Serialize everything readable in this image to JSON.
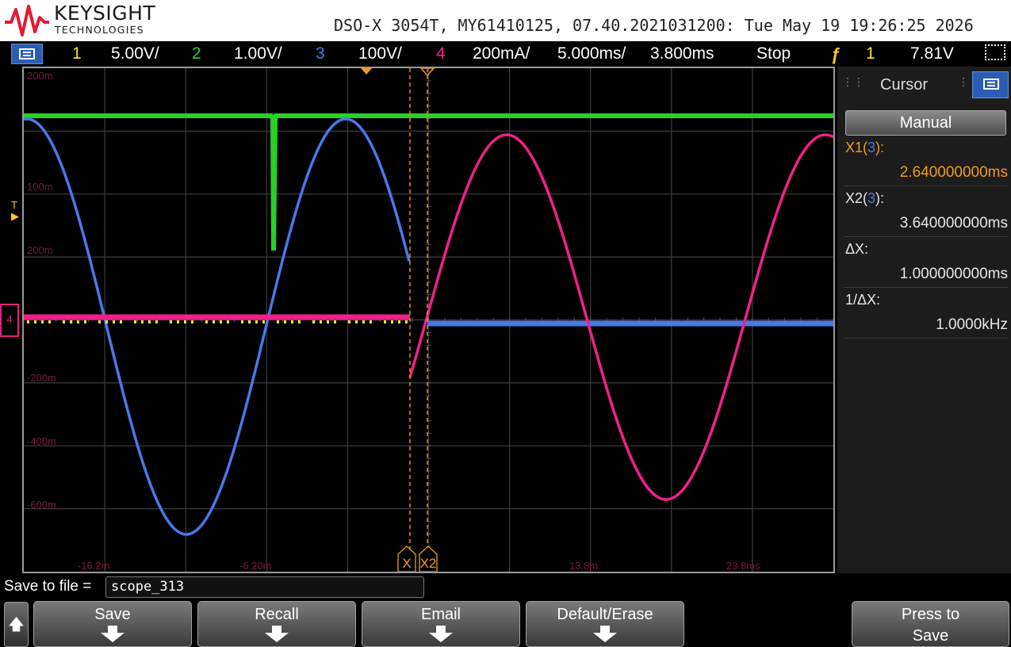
{
  "brand": {
    "name": "KEYSIGHT",
    "subtitle": "TECHNOLOGIES",
    "logo_color": "#e41a32"
  },
  "instrument_info": "DSO-X 3054T, MY61410125, 07.40.2021031200: Tue May 19 19:26:25 2026",
  "statusbar": {
    "menu_icon": "menu-icon",
    "channels": [
      {
        "num": "1",
        "scale": "5.00V/",
        "color": "#f8e030"
      },
      {
        "num": "2",
        "scale": "1.00V/",
        "color": "#28d028"
      },
      {
        "num": "3",
        "scale": "100V/",
        "color": "#4a78e8"
      },
      {
        "num": "4",
        "scale": "200mA/",
        "color": "#f0208a"
      }
    ],
    "timebase": "5.000ms/",
    "delay": "3.800ms",
    "run_state": "Stop",
    "trigger_icon": "trigger-edge-icon",
    "trigger_source": "1",
    "trigger_level": "7.81V",
    "acquire_icon": "acquire-icon"
  },
  "graticule": {
    "y_labels": [
      "200m",
      "100m",
      "200m",
      "-200m",
      "-400m",
      "-600m"
    ],
    "x_labels": [
      "-16.2m",
      "-6.20m",
      "13.8m",
      "23.8ms"
    ],
    "trigger_level_marker": "T",
    "ch4_marker": "4",
    "cursor_x1_label": "X1",
    "cursor_x2_label": "X2",
    "traces": {
      "ch1_color": "#f8e030",
      "ch2_color": "#28d028",
      "ch3_color": "#4a78e8",
      "ch4_color": "#f0208a"
    }
  },
  "cursor_panel": {
    "title": "Cursor",
    "menu_icon": "menu-icon",
    "mode": "Manual",
    "x1_label": "X1(",
    "x1_source": "3",
    "x1_label_end": "):",
    "x1_value": "2.640000000ms",
    "x2_label": "X2(",
    "x2_source": "3",
    "x2_label_end": "):",
    "x2_value": "3.640000000ms",
    "dx_label": "ΔX:",
    "dx_value": "1.000000000ms",
    "inv_dx_label": "1/ΔX:",
    "inv_dx_value": "1.0000kHz",
    "x1_color": "#f39a1e",
    "source_color": "#4a78e8"
  },
  "save": {
    "label": "Save to file =",
    "filename": "scope_313"
  },
  "softkeys": {
    "up_icon": "up-arrow-icon",
    "keys": [
      "Save",
      "Recall",
      "Email",
      "Default/Erase"
    ],
    "press_to_save_line1": "Press to",
    "press_to_save_line2": "Save"
  }
}
